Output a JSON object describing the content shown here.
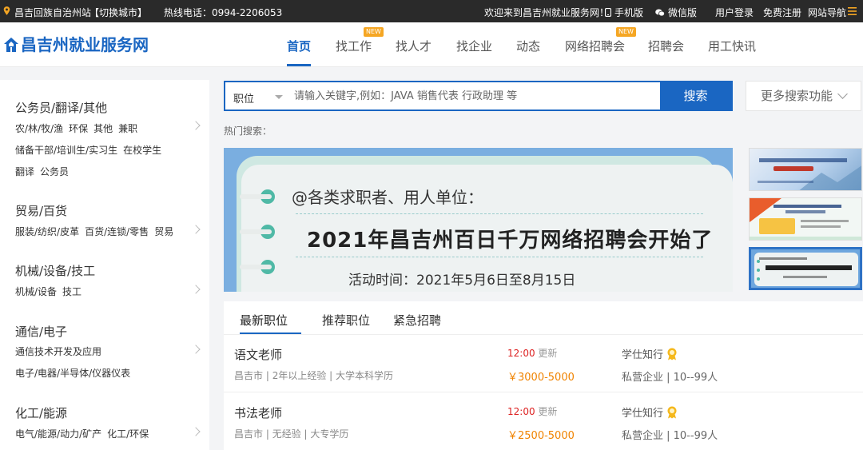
{
  "topbar": {
    "location": "昌吉回族自治州站",
    "switch_city": "【切换城市】",
    "hotline": "热线电话：0994-2206053",
    "welcome": "欢迎来到昌吉州就业服务网！",
    "mobile": "手机版",
    "wechat": "微信版",
    "login": "用户登录",
    "register": "免费注册",
    "site_nav": "网站导航"
  },
  "header": {
    "logo_text": "昌吉州就业服务网",
    "nav": [
      "首页",
      "找工作",
      "找人才",
      "找企业",
      "动态",
      "网络招聘会",
      "招聘会",
      "用工快讯"
    ],
    "new_tag": "NEW"
  },
  "categories": [
    {
      "title": "公务员/翻译/其他",
      "lines": [
        [
          "农/林/牧/渔",
          "环保",
          "其他",
          "兼职"
        ],
        [
          "储备干部/培训生/实习生",
          "在校学生"
        ],
        [
          "翻译",
          "公务员"
        ]
      ]
    },
    {
      "title": "贸易/百货",
      "lines": [
        [
          "服装/纺织/皮革",
          "百货/连锁/零售",
          "贸易"
        ]
      ]
    },
    {
      "title": "机械/设备/技工",
      "lines": [
        [
          "机械/设备",
          "技工"
        ]
      ]
    },
    {
      "title": "通信/电子",
      "lines": [
        [
          "通信技术开发及应用"
        ],
        [
          "电子/电器/半导体/仪器仪表"
        ]
      ]
    },
    {
      "title": "化工/能源",
      "lines": [
        [
          "电气/能源/动力/矿产",
          "化工/环保"
        ]
      ]
    }
  ],
  "search": {
    "type_label": "职位",
    "placeholder": "请输入关键字,例如：JAVA 销售代表 行政助理 等",
    "button": "搜索",
    "more": "更多搜索功能",
    "hot_label": "热门搜索："
  },
  "banner": {
    "line1": "@各类求职者、用人单位：",
    "line2": "2021年昌吉州百日千万网络招聘会开始了",
    "line3": "活动时间：2021年5月6日至8月15日"
  },
  "tabs": [
    "最新职位",
    "推荐职位",
    "紧急招聘"
  ],
  "jobs": [
    {
      "title": "语文老师",
      "location": "昌吉市",
      "experience": "2年以上经验",
      "education": "大学本科学历",
      "time": "12:00",
      "updated": "更新",
      "salary": "￥3000-5000",
      "company": "学仕知行",
      "company_type": "私营企业 | 10--99人"
    },
    {
      "title": "书法老师",
      "location": "昌吉市",
      "experience": "无经验",
      "education": "大专学历",
      "time": "12:00",
      "updated": "更新",
      "salary": "￥2500-5000",
      "company": "学仕知行",
      "company_type": "私营企业 | 10--99人"
    }
  ],
  "colors": {
    "brand": "#1a66c2",
    "salary": "#f08300",
    "time": "#dd2222",
    "new_badge": "#f5a623",
    "topbar": "#2a2a2a"
  }
}
